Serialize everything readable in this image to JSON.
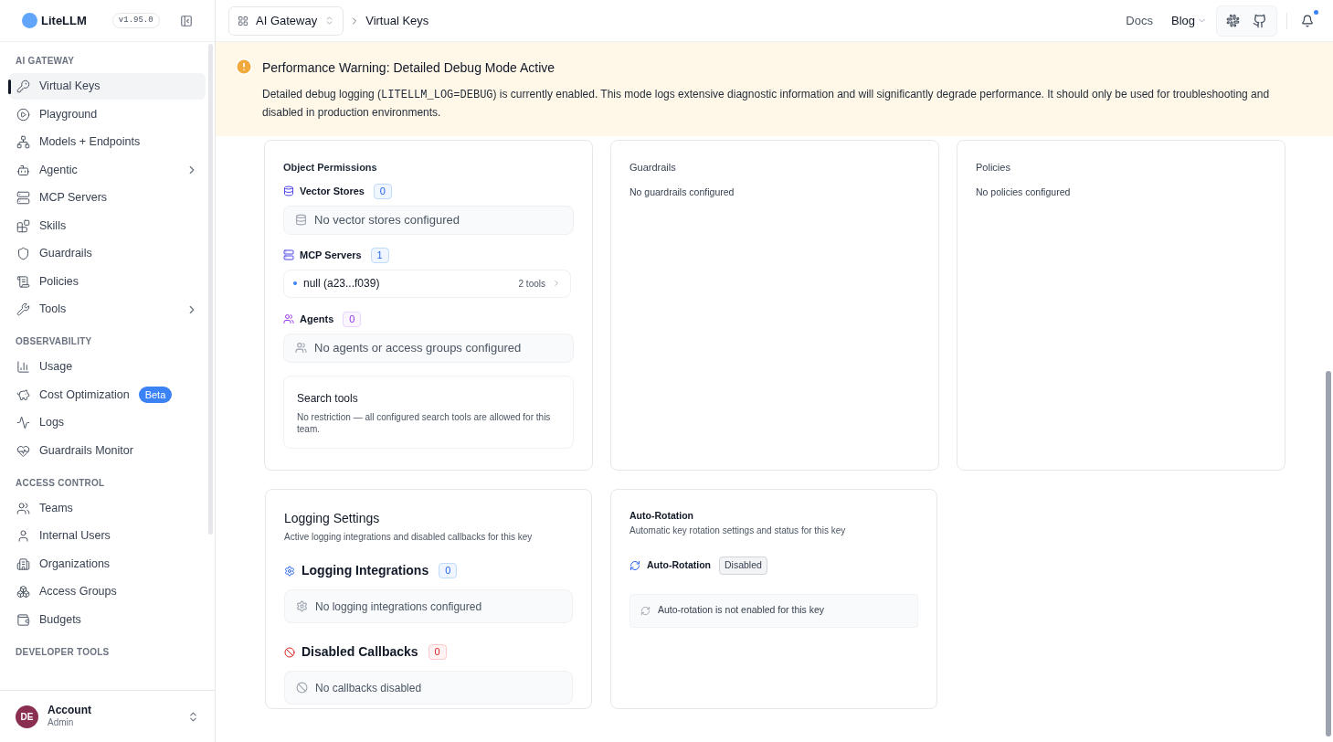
{
  "brand": {
    "name": "LiteLLM",
    "version": "v1.95.0"
  },
  "breadcrumb": {
    "gateway": "AI Gateway",
    "page": "Virtual Keys"
  },
  "top_links": {
    "docs": "Docs",
    "blog": "Blog",
    "notification_dot": true
  },
  "sidebar": {
    "sections": [
      {
        "title": "AI GATEWAY",
        "items": [
          {
            "label": "Virtual Keys",
            "selected": true,
            "expandable": false
          },
          {
            "label": "Playground",
            "selected": false,
            "expandable": false
          },
          {
            "label": "Models + Endpoints",
            "selected": false,
            "expandable": false
          },
          {
            "label": "Agentic",
            "selected": false,
            "expandable": true
          },
          {
            "label": "MCP Servers",
            "selected": false,
            "expandable": false
          },
          {
            "label": "Skills",
            "selected": false,
            "expandable": false
          },
          {
            "label": "Guardrails",
            "selected": false,
            "expandable": false
          },
          {
            "label": "Policies",
            "selected": false,
            "expandable": false
          },
          {
            "label": "Tools",
            "selected": false,
            "expandable": true
          }
        ]
      },
      {
        "title": "OBSERVABILITY",
        "items": [
          {
            "label": "Usage",
            "selected": false,
            "expandable": false
          },
          {
            "label": "Cost Optimization",
            "selected": false,
            "expandable": false,
            "badge": "Beta"
          },
          {
            "label": "Logs",
            "selected": false,
            "expandable": false
          },
          {
            "label": "Guardrails Monitor",
            "selected": false,
            "expandable": false
          }
        ]
      },
      {
        "title": "ACCESS CONTROL",
        "items": [
          {
            "label": "Teams",
            "selected": false,
            "expandable": false
          },
          {
            "label": "Internal Users",
            "selected": false,
            "expandable": false
          },
          {
            "label": "Organizations",
            "selected": false,
            "expandable": false
          },
          {
            "label": "Access Groups",
            "selected": false,
            "expandable": false
          },
          {
            "label": "Budgets",
            "selected": false,
            "expandable": false
          }
        ]
      },
      {
        "title": "DEVELOPER TOOLS"
      }
    ]
  },
  "account": {
    "initials": "DE",
    "name": "Account",
    "role": "Admin"
  },
  "warning": {
    "title": "Performance Warning: Detailed Debug Mode Active",
    "before": "Detailed debug logging (",
    "code": "LITELLM_LOG=DEBUG",
    "after": ") is currently enabled. This mode logs extensive diagnostic information and will significantly degrade performance. It should only be used for troubleshooting and disabled in production environments."
  },
  "object_permissions": {
    "title": "Object Permissions",
    "vector_stores": {
      "label": "Vector Stores",
      "count": "0",
      "empty": "No vector stores configured"
    },
    "mcp_servers": {
      "label": "MCP Servers",
      "count": "1",
      "servers": [
        {
          "name": "null (a23...f039)",
          "tools": "2 tools"
        }
      ]
    },
    "agents": {
      "label": "Agents",
      "count": "0",
      "empty": "No agents or access groups configured"
    },
    "search_tools": {
      "title": "Search tools",
      "text": "No restriction — all configured search tools are allowed for this team."
    }
  },
  "guardrails": {
    "title": "Guardrails",
    "text": "No guardrails configured"
  },
  "policies": {
    "title": "Policies",
    "text": "No policies configured"
  },
  "logging": {
    "title": "Logging Settings",
    "subtitle": "Active logging integrations and disabled callbacks for this key",
    "integrations": {
      "label": "Logging Integrations",
      "count": "0",
      "empty": "No logging integrations configured"
    },
    "callbacks": {
      "label": "Disabled Callbacks",
      "count": "0",
      "empty": "No callbacks disabled"
    }
  },
  "auto_rotation": {
    "title": "Auto-Rotation",
    "subtitle": "Automatic key rotation settings and status for this key",
    "label": "Auto-Rotation",
    "status": "Disabled",
    "enabled": false,
    "message": "Auto-rotation is not enabled for this key"
  }
}
